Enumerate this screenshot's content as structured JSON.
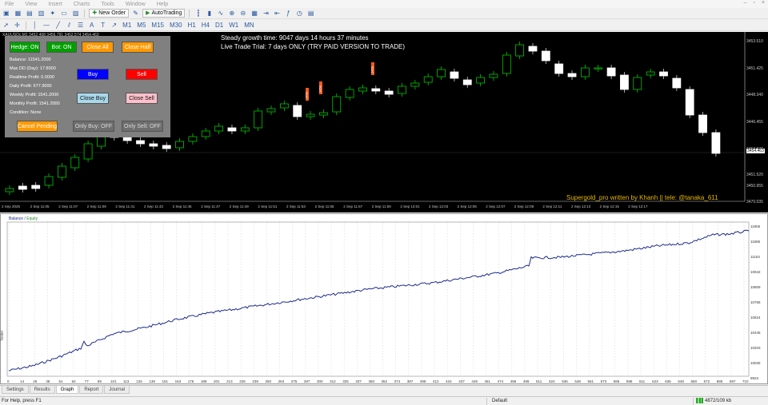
{
  "menu": [
    "File",
    "View",
    "Insert",
    "Charts",
    "Tools",
    "Window",
    "Help"
  ],
  "toolbar": {
    "new_order": "New Order",
    "autotrading": "AutoTrading"
  },
  "chart": {
    "symbol_line": "XAUUSDc,M1  3452.468 3456.791 3452.574 3454.463",
    "steady_growth": "Steady growth time: 9047 days 14 hours 37 minutes",
    "trial_notice": "Live Trade Trial: 7 days ONLY  (TRY PAID VERSION TO TRADE)",
    "credit": "Supergold_pro written by Khanh || tele: @tanaka_611",
    "current_price": "3454.463",
    "price_labels": [
      "3453.510",
      "3451.425",
      "3448.340",
      "3446.455",
      "3453.520",
      "3451.520",
      "3450.955",
      "3470.035"
    ],
    "time_labels": [
      "2 Sep 2025",
      "2 Sep 11:05",
      "2 Sep 11:07",
      "2 Sep 11:09",
      "2 Sep 11:41",
      "2 Sep 11:43",
      "2 Sep 11:45",
      "2 Sep 11:47",
      "2 Sep 11:49",
      "2 Sep 11:51",
      "2 Sep 11:53",
      "2 Sep 11:55",
      "2 Sep 11:57",
      "2 Sep 11:59",
      "2 Sep 12:01",
      "2 Sep 12:03",
      "2 Sep 12:05",
      "2 Sep 12:07",
      "2 Sep 12:09",
      "2 Sep 12:11",
      "2 Sep 12:13",
      "2 Sep 12:15",
      "2 Sep 12:17"
    ],
    "trade_markers": [
      "1450",
      "1450",
      "1450"
    ],
    "candle_colors": {
      "bull": "#00c800",
      "bear": "#ffffff",
      "background": "#000000"
    }
  },
  "panel": {
    "hedge": "Hedge: ON",
    "bot": "Bot: ON",
    "close_all": "Close All",
    "close_half": "Close Half",
    "buy": "Buy",
    "sell": "Sell",
    "close_buy": "Close Buy",
    "close_sell": "Close Sell",
    "cancel_pending": "Cancel Pending",
    "only_buy": "Only Buy: OFF",
    "only_sell": "Only Sell: OFF",
    "info": [
      "Balance: 11541.2000",
      "Max DD (Day): 17.8000",
      "Realtime Profit: 0.0000",
      "Daily Profit: 677.9000",
      "Weekly Profit: 1541.2000",
      "Monthly Profit: 1541.2000",
      "Condition: None"
    ],
    "colors": {
      "hedge": "#00a000",
      "bot": "#00a000",
      "orange": "#ff9a00",
      "buy": "#0000ff",
      "sell": "#ff0000",
      "close_buy": "#a8d8ea",
      "close_sell": "#ffc0cb",
      "grey_button": "#6e6e6e",
      "panel_bg": "#808080"
    }
  },
  "equity": {
    "legend_balance": "Balance",
    "legend_sep": " / ",
    "legend_equity": "Equity",
    "y_labels": [
      "11906",
      "11585",
      "11163",
      "10942",
      "10809",
      "10766",
      "10624",
      "10445",
      "10203",
      "10025",
      "9923"
    ],
    "x_labels": [
      "0",
      "14",
      "26",
      "38",
      "51",
      "64",
      "77",
      "89",
      "101",
      "113",
      "126",
      "139",
      "151",
      "163",
      "176",
      "188",
      "201",
      "213",
      "226",
      "239",
      "250",
      "263",
      "275",
      "287",
      "300",
      "312",
      "325",
      "337",
      "350",
      "362",
      "374",
      "387",
      "399",
      "412",
      "424",
      "437",
      "449",
      "461",
      "474",
      "486",
      "499",
      "511",
      "524",
      "536",
      "548",
      "561",
      "573",
      "585",
      "598",
      "611",
      "623",
      "635",
      "648",
      "660",
      "672",
      "685",
      "697",
      "710"
    ],
    "line_color": "#1c2a8c",
    "side_label": "Tester"
  },
  "tabs": [
    "Settings",
    "Results",
    "Graph",
    "Report",
    "Journal"
  ],
  "status": {
    "help": "For Help, press F1",
    "profile": "Default",
    "traffic": "4872/109 kb"
  }
}
